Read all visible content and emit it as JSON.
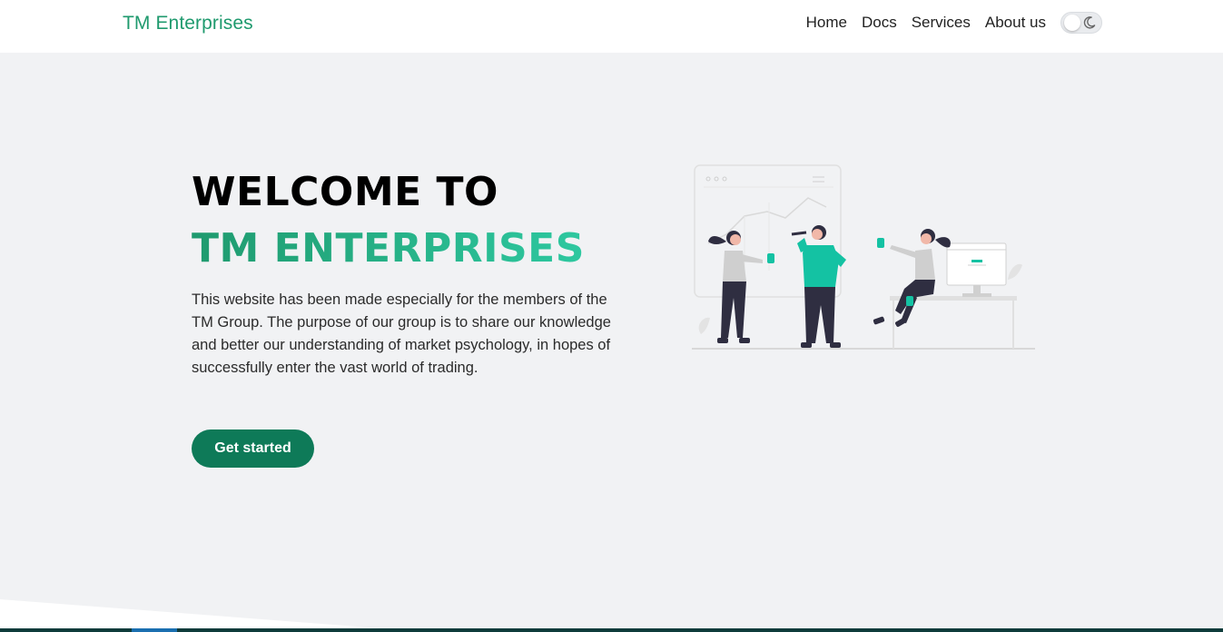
{
  "brand": {
    "name": "TM Enterprises"
  },
  "nav": {
    "items": [
      "Home",
      "Docs",
      "Services",
      "About us"
    ],
    "theme_toggle": {
      "state": "light",
      "icon": "moon-icon"
    }
  },
  "hero": {
    "title_line1": "WELCOME TO",
    "title_line2": "TM ENTERPRISES",
    "description": "This website has been made especially for the members of the TM Group. The purpose of our group is to share our knowledge and better our understanding of market psychology, in hopes of successfully enter the vast world of trading.",
    "cta_label": "Get started",
    "illustration": "team-collaboration-illustration"
  },
  "colors": {
    "accent": "#1f9a6e",
    "accent_light": "#2ec8a0",
    "button": "#0e7a58",
    "background": "#f1f2f4",
    "header": "#ffffff"
  }
}
